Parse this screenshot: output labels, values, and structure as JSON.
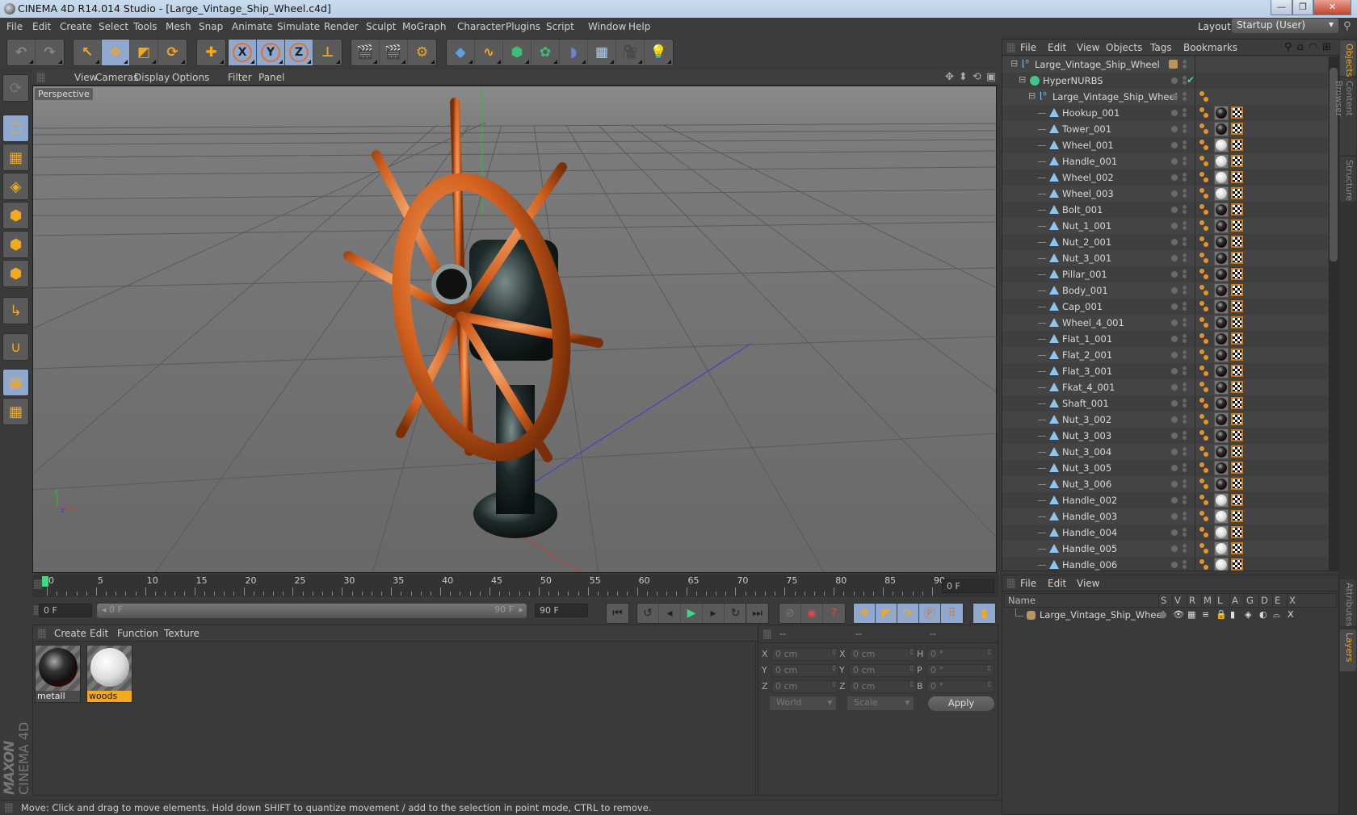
{
  "window": {
    "title": "CINEMA 4D R14.014 Studio - [Large_Vintage_Ship_Wheel.c4d]",
    "minimize": "—",
    "maximize": "❐",
    "close": "✕"
  },
  "menubar": [
    "File",
    "Edit",
    "Create",
    "Select",
    "Tools",
    "Mesh",
    "Snap",
    "Animate",
    "Simulate",
    "Render",
    "Sculpt",
    "MoGraph",
    "Character",
    "Plugins",
    "Script",
    "Window",
    "Help"
  ],
  "layout": {
    "label": "Layout:",
    "value": "Startup (User)"
  },
  "toolbar": {
    "groups": [
      [
        {
          "icon": "undo-icon",
          "glyph": "↶"
        },
        {
          "icon": "redo-icon",
          "glyph": "↷"
        }
      ],
      [
        {
          "icon": "live-selection-icon",
          "glyph": "↖",
          "active": false
        },
        {
          "icon": "move-icon",
          "glyph": "✥",
          "active": true
        },
        {
          "icon": "scale-icon",
          "glyph": "◩",
          "active": false
        },
        {
          "icon": "rotate-icon",
          "glyph": "⟳",
          "active": false
        }
      ],
      [
        {
          "icon": "add-icon",
          "glyph": "✚"
        }
      ],
      [
        {
          "icon": "x-axis-icon",
          "glyph": "X",
          "active": true
        },
        {
          "icon": "y-axis-icon",
          "glyph": "Y",
          "active": true
        },
        {
          "icon": "z-axis-icon",
          "glyph": "Z",
          "active": true
        },
        {
          "icon": "coordinate-system-icon",
          "glyph": "⊥"
        }
      ],
      [
        {
          "icon": "render-view-icon",
          "glyph": "🎬"
        },
        {
          "icon": "render-picture-viewer-icon",
          "glyph": "🎬"
        },
        {
          "icon": "render-settings-icon",
          "glyph": "⚙"
        }
      ],
      [
        {
          "icon": "cube-icon",
          "glyph": "◆"
        },
        {
          "icon": "spline-icon",
          "glyph": "∿"
        },
        {
          "icon": "nurbs-icon",
          "glyph": "⬢"
        },
        {
          "icon": "array-icon",
          "glyph": "✿"
        },
        {
          "icon": "deformer-icon",
          "glyph": "◗"
        },
        {
          "icon": "floor-icon",
          "glyph": "▦"
        },
        {
          "icon": "camera-icon",
          "glyph": "🎥"
        },
        {
          "icon": "light-icon",
          "glyph": "💡"
        }
      ]
    ]
  },
  "left_tools": [
    {
      "icon": "make-editable-icon",
      "active": false
    },
    {
      "icon": "model-mode-icon",
      "active": true
    },
    {
      "icon": "texture-mode-icon",
      "active": false
    },
    {
      "icon": "workplane-mode-icon",
      "active": false
    },
    {
      "icon": "points-mode-icon",
      "active": false
    },
    {
      "icon": "edges-mode-icon",
      "active": false
    },
    {
      "icon": "polygons-mode-icon",
      "active": false
    },
    {
      "icon": "axis-mode-icon",
      "active": false
    },
    {
      "icon": "snap-magnet-icon",
      "active": false
    },
    {
      "icon": "locked-workplane-icon",
      "active": true
    },
    {
      "icon": "planar-workplane-icon",
      "active": false
    }
  ],
  "viewport": {
    "menu": [
      "View",
      "Cameras",
      "Display",
      "Options",
      "Filter",
      "Panel"
    ],
    "label": "Perspective",
    "nav_icons": [
      "move-view-icon",
      "zoom-view-icon",
      "rotate-view-icon",
      "maximize-view-icon"
    ]
  },
  "timeline": {
    "ticks": [
      "0",
      "5",
      "10",
      "15",
      "20",
      "25",
      "30",
      "35",
      "40",
      "45",
      "50",
      "55",
      "60",
      "65",
      "70",
      "75",
      "80",
      "85",
      "90"
    ],
    "current_frame": 0,
    "end_frame_field": "0 F",
    "start_field": "0 F",
    "range_start": "0 F",
    "range_end": "90 F",
    "end_field": "90 F"
  },
  "transport": {
    "nav": [
      "go-to-start-icon",
      "step-back-icon",
      "prev-key-icon",
      "play-icon",
      "next-key-icon",
      "step-forward-icon",
      "go-to-end-icon"
    ],
    "record": [
      "auto-keyframe-icon",
      "record-icon",
      "help-keyframe-icon"
    ],
    "keys": [
      "key-position-icon",
      "key-scale-icon",
      "key-rotation-icon",
      "key-parameter-icon",
      "key-point-level-icon"
    ],
    "timeline_button": "timeline-icon"
  },
  "material_manager": {
    "menu": [
      "Create",
      "Edit",
      "Function",
      "Texture"
    ],
    "materials": [
      {
        "name": "metall",
        "selected": false,
        "type": "metal"
      },
      {
        "name": "woods",
        "selected": true,
        "type": "wood"
      }
    ]
  },
  "coordinates": {
    "headers": [
      "--",
      "--",
      "--"
    ],
    "rows": [
      {
        "l1": "X",
        "v1": "0 cm",
        "l2": "X",
        "v2": "0 cm",
        "l3": "H",
        "v3": "0 °"
      },
      {
        "l1": "Y",
        "v1": "0 cm",
        "l2": "Y",
        "v2": "0 cm",
        "l3": "P",
        "v3": "0 °"
      },
      {
        "l1": "Z",
        "v1": "0 cm",
        "l2": "Z",
        "v2": "0 cm",
        "l3": "B",
        "v3": "0 °"
      }
    ],
    "mode": "World",
    "transform": "Scale",
    "apply": "Apply"
  },
  "status": "Move: Click and drag to move elements. Hold down SHIFT to quantize movement / add to the selection in point mode, CTRL to remove.",
  "brand": {
    "maxon": "MAXON",
    "product": "CINEMA 4D"
  },
  "object_manager": {
    "menu": [
      "File",
      "Edit",
      "View",
      "Objects",
      "Tags",
      "Bookmarks"
    ],
    "root": "Large_Vintage_Ship_Wheel",
    "hypernurbs": "HyperNURBS",
    "group": "Large_Vintage_Ship_Wheel",
    "objects": [
      {
        "name": "Hookup_001",
        "mat": "metal"
      },
      {
        "name": "Tower_001",
        "mat": "metal"
      },
      {
        "name": "Wheel_001",
        "mat": "wood"
      },
      {
        "name": "Handle_001",
        "mat": "wood"
      },
      {
        "name": "Wheel_002",
        "mat": "wood"
      },
      {
        "name": "Wheel_003",
        "mat": "wood"
      },
      {
        "name": "Bolt_001",
        "mat": "metal"
      },
      {
        "name": "Nut_1_001",
        "mat": "metal"
      },
      {
        "name": "Nut_2_001",
        "mat": "metal"
      },
      {
        "name": "Nut_3_001",
        "mat": "metal"
      },
      {
        "name": "Pillar_001",
        "mat": "metal"
      },
      {
        "name": "Body_001",
        "mat": "metal"
      },
      {
        "name": "Cap_001",
        "mat": "metal"
      },
      {
        "name": "Wheel_4_001",
        "mat": "metal"
      },
      {
        "name": "Flat_1_001",
        "mat": "metal"
      },
      {
        "name": "Flat_2_001",
        "mat": "metal"
      },
      {
        "name": "Flat_3_001",
        "mat": "metal"
      },
      {
        "name": "Fkat_4_001",
        "mat": "metal"
      },
      {
        "name": "Shaft_001",
        "mat": "metal"
      },
      {
        "name": "Nut_3_002",
        "mat": "metal"
      },
      {
        "name": "Nut_3_003",
        "mat": "metal"
      },
      {
        "name": "Nut_3_004",
        "mat": "metal"
      },
      {
        "name": "Nut_3_005",
        "mat": "metal"
      },
      {
        "name": "Nut_3_006",
        "mat": "metal"
      },
      {
        "name": "Handle_002",
        "mat": "wood"
      },
      {
        "name": "Handle_003",
        "mat": "wood"
      },
      {
        "name": "Handle_004",
        "mat": "wood"
      },
      {
        "name": "Handle_005",
        "mat": "wood"
      },
      {
        "name": "Handle_006",
        "mat": "wood"
      }
    ]
  },
  "side_tabs_top": [
    {
      "label": "Objects",
      "active": true
    },
    {
      "label": "Content Browser",
      "active": false
    },
    {
      "label": "Structure",
      "active": false
    }
  ],
  "side_tabs_bottom": [
    {
      "label": "Attributes",
      "active": false
    },
    {
      "label": "Layers",
      "active": true
    }
  ],
  "layer_manager": {
    "menu": [
      "File",
      "Edit",
      "View"
    ],
    "columns": [
      "Name",
      "S",
      "V",
      "R",
      "M",
      "L",
      "A",
      "G",
      "D",
      "E",
      "X"
    ],
    "layers": [
      {
        "name": "Large_Vintage_Ship_Wheel",
        "color": "#b8955a"
      }
    ]
  },
  "colors": {
    "accent": "#f4a81c",
    "active_button": "#8fa8d0",
    "layer_color": "#b8955a",
    "play": "#3ddc84"
  }
}
